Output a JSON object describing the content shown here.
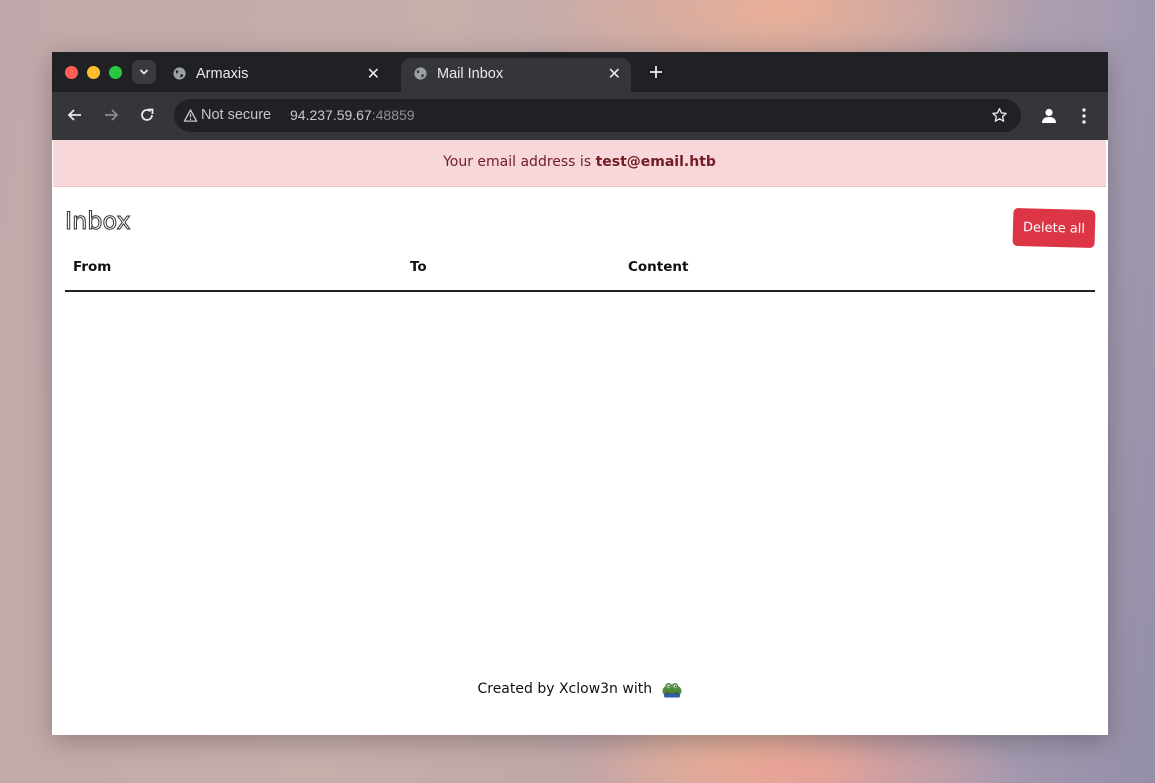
{
  "browser": {
    "tabs": [
      {
        "title": "Armaxis",
        "active": false,
        "icon": "globe-icon"
      },
      {
        "title": "Mail Inbox",
        "active": true,
        "icon": "globe-icon"
      }
    ],
    "address_bar": {
      "security_label": "Not secure",
      "url_host": "94.237.59.67",
      "url_port": ":48859"
    }
  },
  "page": {
    "alert": {
      "prefix": "Your email address is ",
      "email": "test@email.htb"
    },
    "title": "Inbox",
    "delete_all_label": "Delete all",
    "table": {
      "columns": [
        "From",
        "To",
        "Content"
      ],
      "rows": []
    },
    "footer": {
      "text": "Created by Xclow3n with",
      "icon": "pepe-frog-icon"
    }
  },
  "colors": {
    "alert_bg": "#f8d7da",
    "alert_text": "#721c24",
    "danger_button": "#dc3545",
    "browser_frame": "#202124",
    "toolbar": "#35363a"
  }
}
